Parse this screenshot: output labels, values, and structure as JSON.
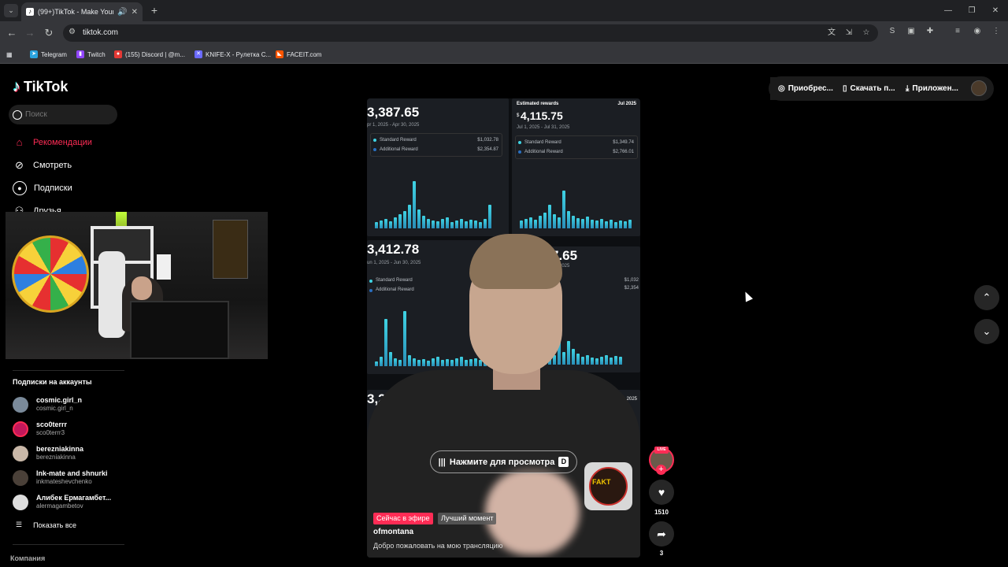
{
  "browser": {
    "tab_title": "(99+)TikTok - Make Your Da",
    "tab_favicon": "tiktok-icon",
    "url": "tiktok.com",
    "bookmarks": [
      {
        "label": "Telegram",
        "icon": "telegram-icon",
        "color": "#2aa3df"
      },
      {
        "label": "Twitch",
        "icon": "twitch-icon",
        "color": "#9146ff"
      },
      {
        "label": "(155) Discord | @m...",
        "icon": "discord-icon",
        "color": "#e53935"
      },
      {
        "label": "KNIFE-X - Рулетка С...",
        "icon": "knifex-icon",
        "color": "#6a6aff"
      },
      {
        "label": "FACEIT.com",
        "icon": "faceit-icon",
        "color": "#ff5500"
      }
    ]
  },
  "sidebar": {
    "logo": "TikTok",
    "search_placeholder": "Поиск",
    "nav": [
      {
        "label": "Рекомендации",
        "icon": "home-icon",
        "active": true
      },
      {
        "label": "Смотреть",
        "icon": "compass-icon",
        "active": false
      },
      {
        "label": "Подписки",
        "icon": "following-icon",
        "active": false
      },
      {
        "label": "Друзья",
        "icon": "friends-icon",
        "active": false
      }
    ],
    "following_title": "Подписки на аккаунты",
    "accounts": [
      {
        "name": "cosmic.girl_n",
        "handle": "cosmic.girl_n"
      },
      {
        "name": "sco0terrr",
        "handle": "sco0terrr3"
      },
      {
        "name": "berezniakinna",
        "handle": "berezniakinna"
      },
      {
        "name": "Ink-mate and shnurki",
        "handle": "inkmateshevchenko"
      },
      {
        "name": "Алибек Ермагамбет...",
        "handle": "alermagambetov"
      }
    ],
    "show_all": "Показать все",
    "company": "Компания"
  },
  "topbar": {
    "buy_coins": "Приобрес...",
    "download_app": "Скачать п...",
    "app": "Приложен..."
  },
  "video": {
    "panels": [
      {
        "amount": "3,387.65",
        "range": "pr 1, 2025 - Apr 30, 2025",
        "standard": "$1,032.78",
        "additional": "$2,354.87"
      },
      {
        "amount": "4,115.75",
        "heading": "Estimated rewards",
        "month": "Jul 2025",
        "range": "Jul 1, 2025 - Jul 31, 2025",
        "standard": "$1,349.74",
        "additional": "$2,766.01"
      },
      {
        "amount": "3,412.78",
        "range": "un 1, 2025 - Jun 30, 2025"
      },
      {
        "amount": "7.65",
        "range": "30, 2025",
        "standard": "$1,032",
        "additional": "$2,354"
      },
      {
        "amount": "3,234",
        "month": "Aug 2025"
      }
    ],
    "legend_standard": "Standard Reward",
    "legend_additional": "Additional Reward",
    "currency": "$",
    "watch_button": "Нажмите для просмотра",
    "watch_key": "D",
    "badge_live": "Сейчас в эфире",
    "badge_best": "Лучший момент",
    "author": "ofmontana",
    "caption": "Добро пожаловать на мою трансляцию",
    "thumb_text": "FAKT"
  },
  "actions": {
    "live_tag": "LIVE",
    "likes": "1510",
    "shares": "3"
  },
  "colors": {
    "accent": "#fe2c55",
    "bar": "#3fd3e3"
  }
}
